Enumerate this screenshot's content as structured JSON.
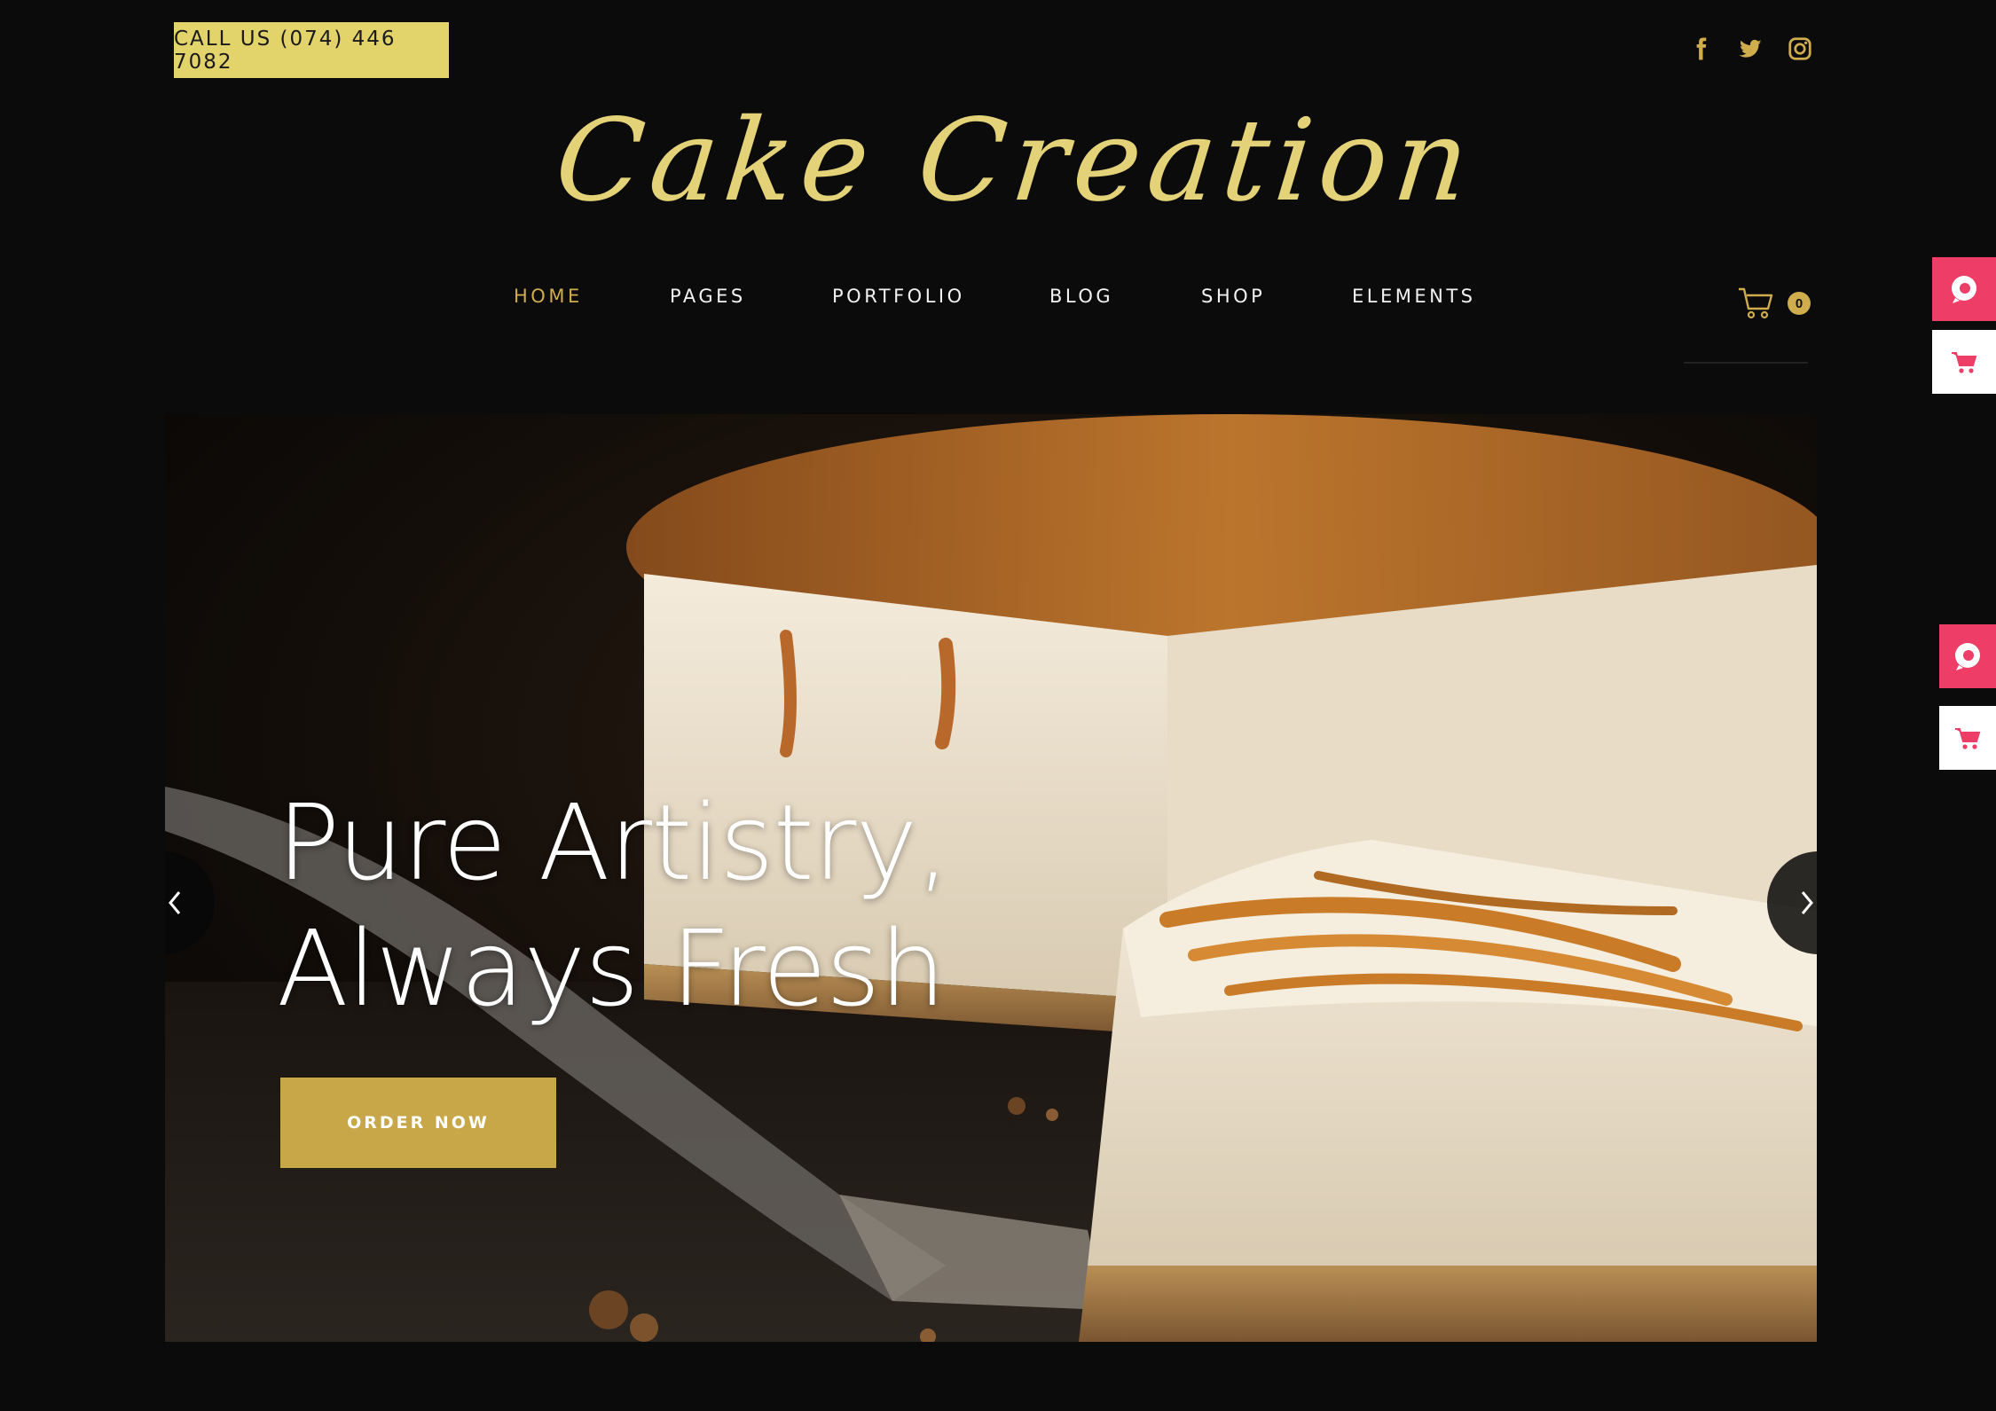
{
  "topbar": {
    "call_label": "CALL US (074) 446 7082",
    "socials": [
      {
        "icon": "facebook-icon"
      },
      {
        "icon": "twitter-icon"
      },
      {
        "icon": "instagram-icon"
      }
    ]
  },
  "logo": {
    "text": "Cake Creation"
  },
  "nav": {
    "items": [
      {
        "label": "HOME",
        "active": true
      },
      {
        "label": "PAGES",
        "active": false
      },
      {
        "label": "PORTFOLIO",
        "active": false
      },
      {
        "label": "BLOG",
        "active": false
      },
      {
        "label": "SHOP",
        "active": false
      },
      {
        "label": "ELEMENTS",
        "active": false
      }
    ],
    "cart_count": "0"
  },
  "hero": {
    "title_line1": "Pure Artistry,",
    "title_line2": "Always Fresh",
    "button_label": "ORDER NOW"
  },
  "colors": {
    "background": "#0b0b0c",
    "accent_gold": "#cfac4c",
    "call_badge": "#e3d36b",
    "logo": "#e3d278",
    "side_widget": "#ee3e67"
  }
}
